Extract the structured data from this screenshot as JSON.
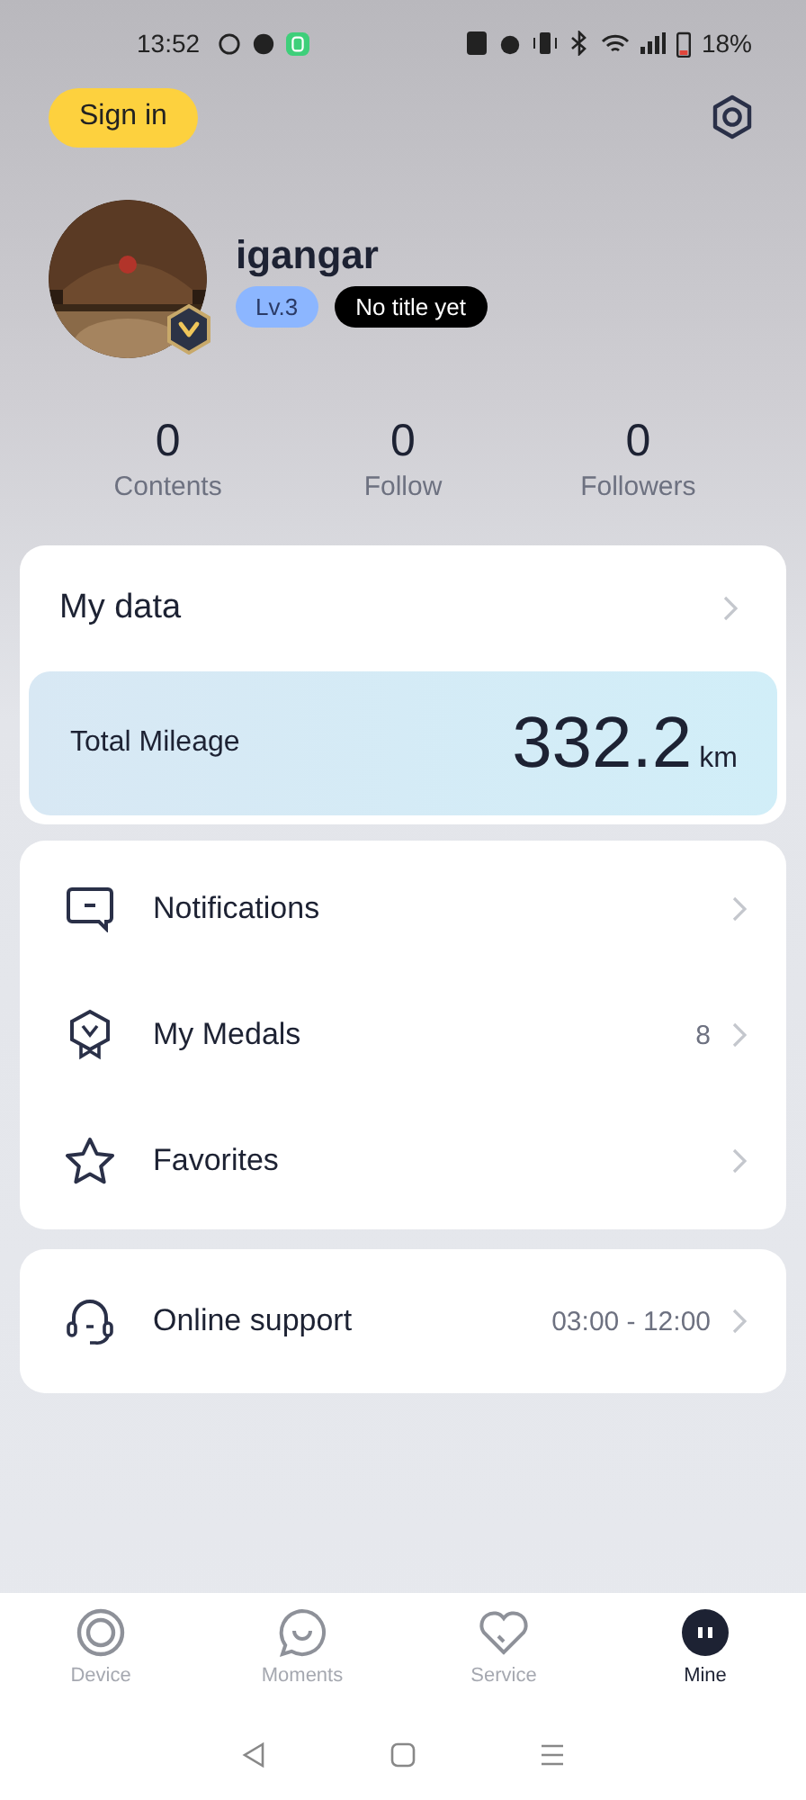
{
  "status_bar": {
    "time": "13:52",
    "battery": "18%"
  },
  "header": {
    "sign_in": "Sign in"
  },
  "profile": {
    "username": "igangar",
    "level": "Lv.3",
    "title_badge": "No title yet"
  },
  "stats": [
    {
      "value": "0",
      "label": "Contents"
    },
    {
      "value": "0",
      "label": "Follow"
    },
    {
      "value": "0",
      "label": "Followers"
    }
  ],
  "my_data": {
    "title": "My data",
    "mileage_label": "Total Mileage",
    "mileage_value": "332.2",
    "mileage_unit": "km"
  },
  "menu": [
    {
      "label": "Notifications"
    },
    {
      "label": "My Medals",
      "value": "8"
    },
    {
      "label": "Favorites"
    }
  ],
  "support": {
    "label": "Online support",
    "value": "03:00 - 12:00"
  },
  "tabs": [
    {
      "label": "Device",
      "selected": false
    },
    {
      "label": "Moments",
      "selected": false
    },
    {
      "label": "Service",
      "selected": false
    },
    {
      "label": "Mine",
      "selected": true
    }
  ]
}
